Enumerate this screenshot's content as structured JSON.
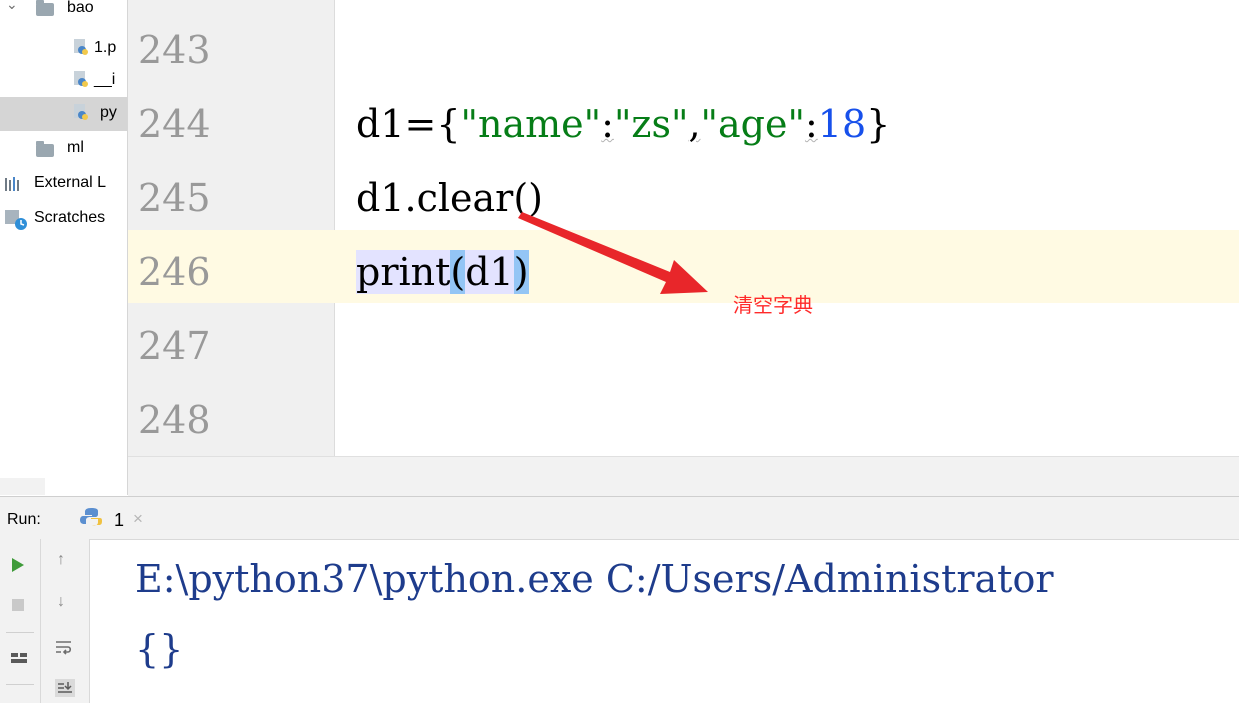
{
  "project_tree": {
    "items": [
      {
        "label": "bao",
        "kind": "folder",
        "expanded": true
      },
      {
        "label": "1.p",
        "kind": "py-file"
      },
      {
        "label": "__i",
        "kind": "py-file"
      },
      {
        "label": "py",
        "kind": "py-file",
        "selected": true
      },
      {
        "label": "ml",
        "kind": "folder"
      },
      {
        "label": "External L",
        "kind": "libraries"
      },
      {
        "label": "Scratches",
        "kind": "scratches"
      }
    ]
  },
  "editor": {
    "line_numbers": [
      "243",
      "244",
      "245",
      "246",
      "247",
      "248"
    ],
    "current_line": "246",
    "lines": {
      "l244": {
        "a": "d1={",
        "b": "\"name\"",
        "c": ":",
        "d": "\"zs\"",
        "e": ",",
        "f": "\"age\"",
        "g": ":",
        "h": "18",
        "i": "}"
      },
      "l245": "d1.clear()",
      "l246": {
        "a": "print",
        "b": "(",
        "c": "d1",
        "d": ")"
      }
    },
    "annotation": {
      "text": "清空字典",
      "color": "#ff2a2a"
    }
  },
  "run_panel": {
    "label": "Run:",
    "tab_label": "1",
    "close_glyph": "×",
    "output_lines": [
      "E:\\python37\\python.exe C:/Users/Administrator",
      "{}"
    ]
  },
  "colors": {
    "string": "#067d17",
    "number": "#1750eb",
    "current_line": "#fffae3",
    "bracket_match": "#93c5f5",
    "arrow": "#e8262a"
  }
}
